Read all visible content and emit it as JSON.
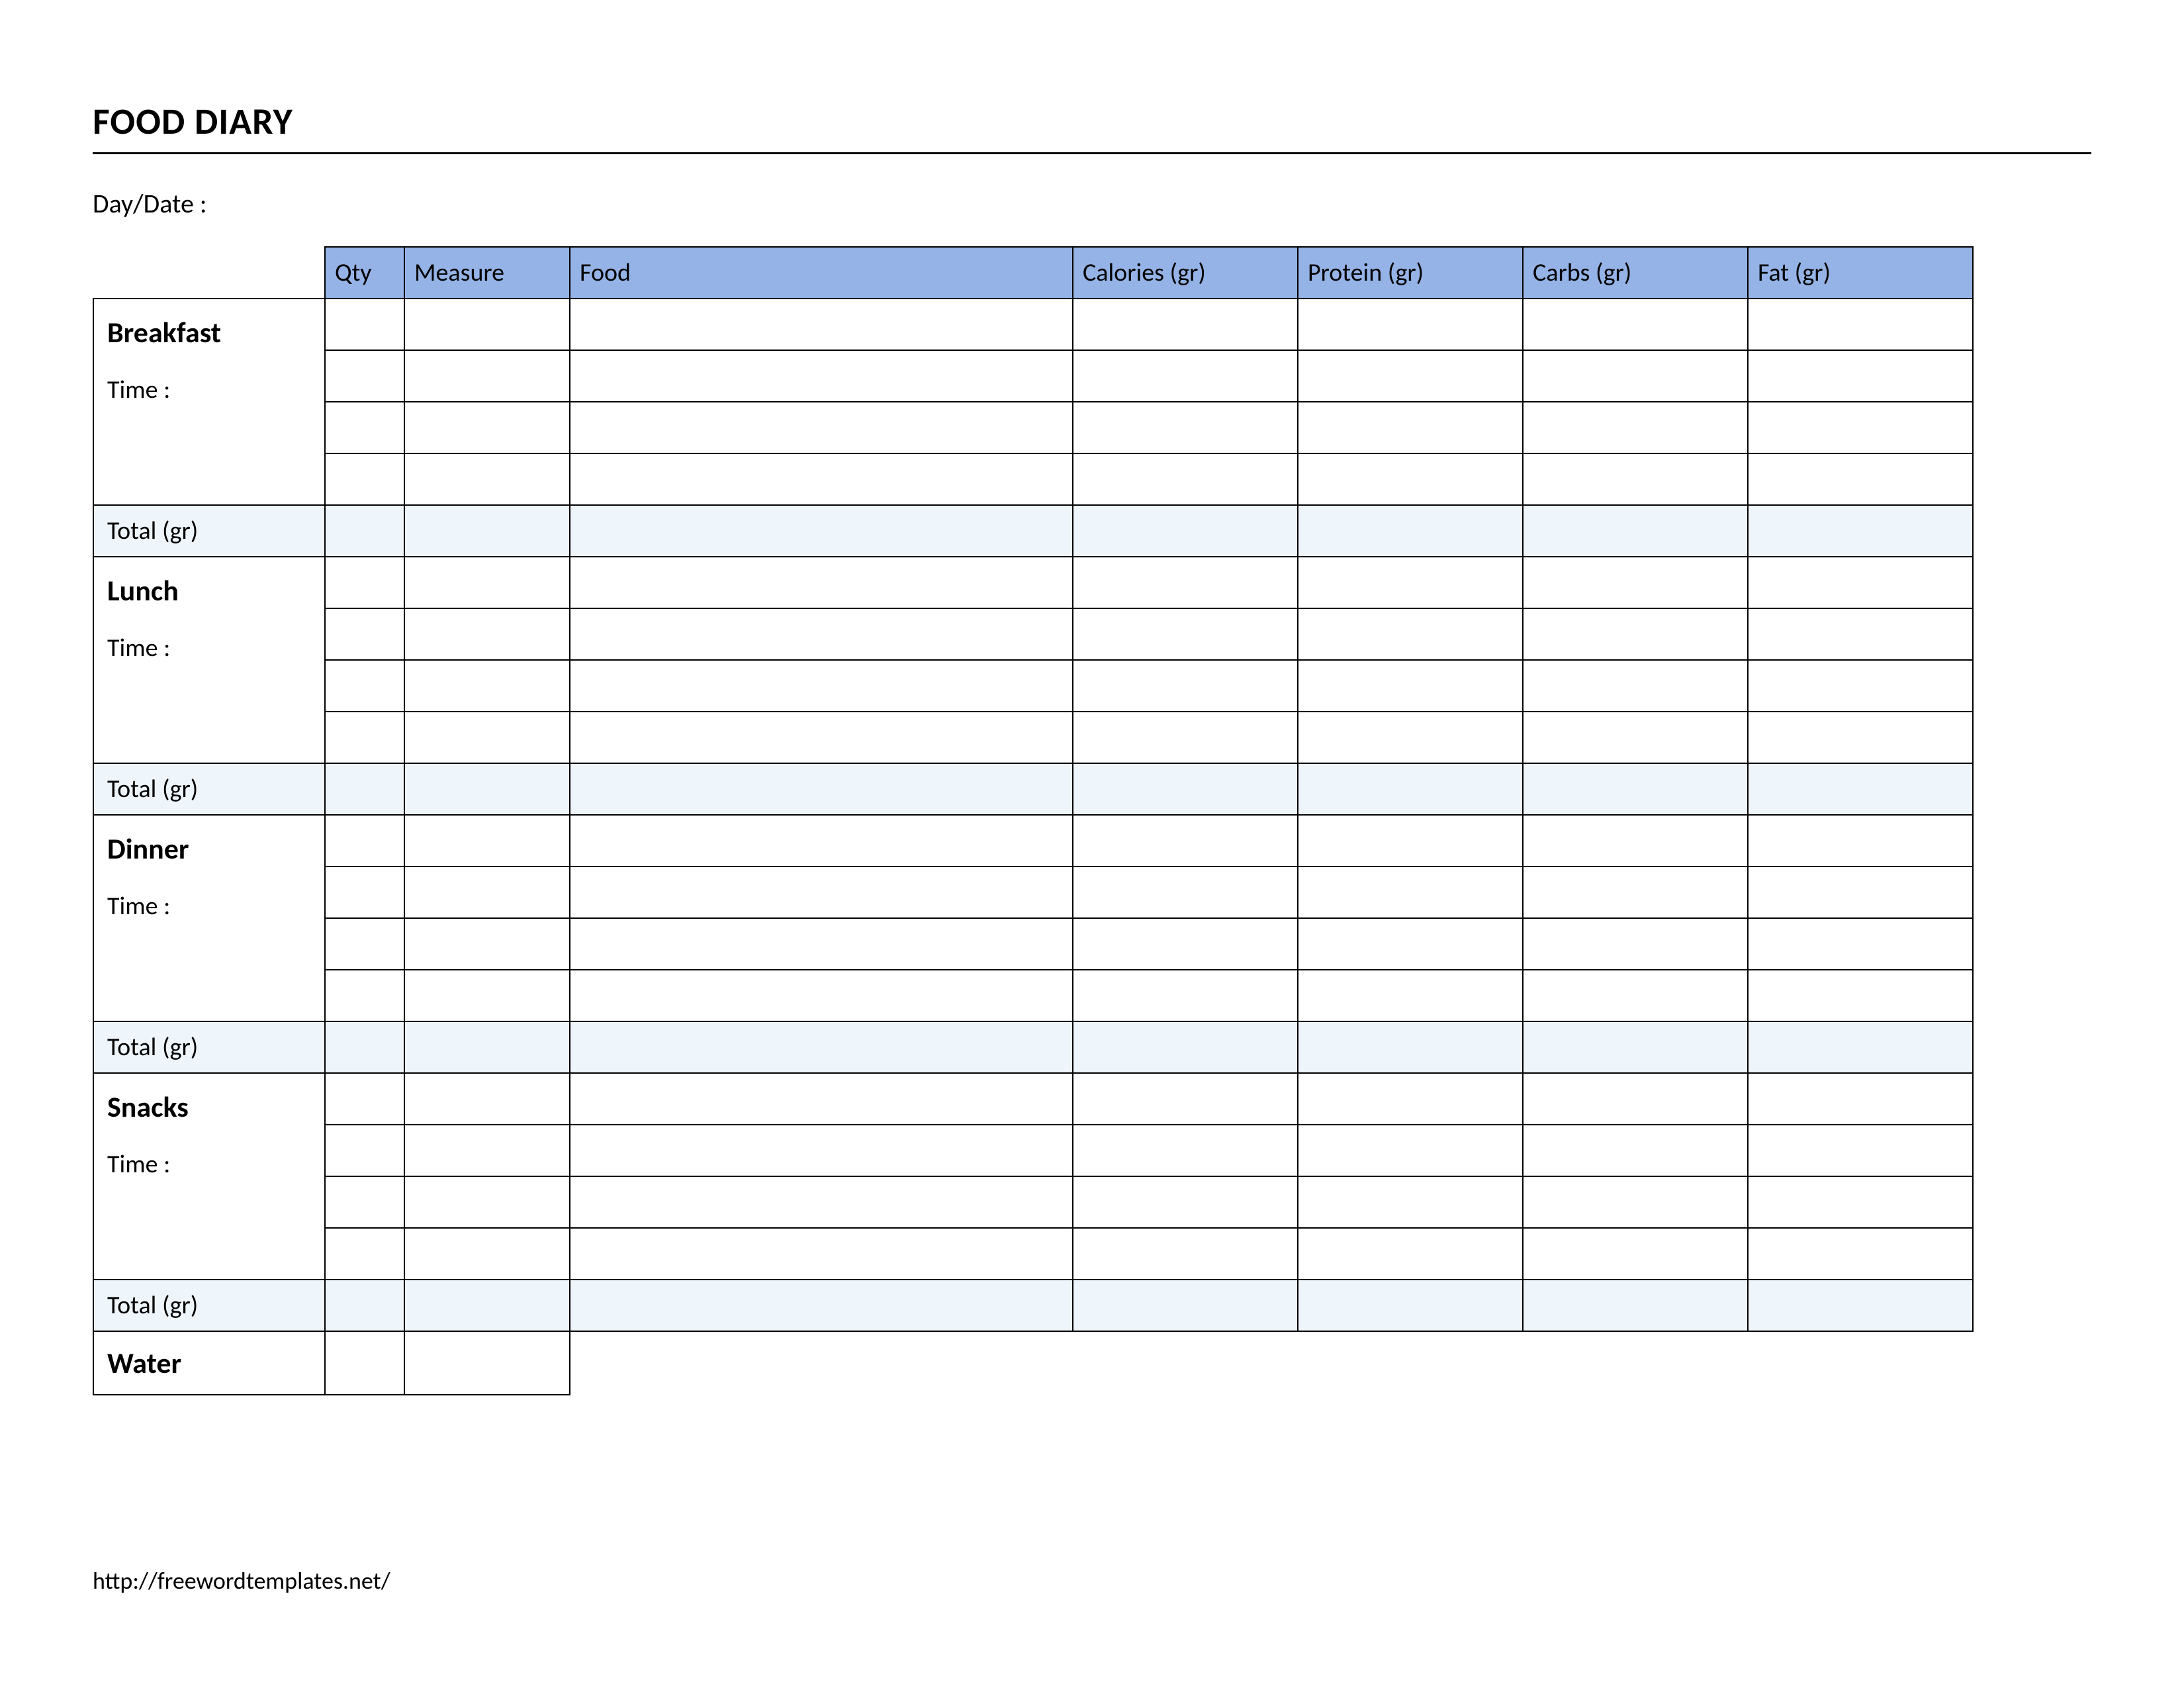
{
  "title": "FOOD DIARY",
  "day_date_label": "Day/Date :",
  "columns": {
    "qty": "Qty",
    "measure": "Measure",
    "food": "Food",
    "calories": "Calories (gr)",
    "protein": "Protein (gr)",
    "carbs": "Carbs (gr)",
    "fat": "Fat (gr)"
  },
  "meals": [
    {
      "name": "Breakfast",
      "time_label": "Time :",
      "total_label": "Total (gr)"
    },
    {
      "name": "Lunch",
      "time_label": "Time :",
      "total_label": "Total (gr)"
    },
    {
      "name": "Dinner",
      "time_label": "Time :",
      "total_label": "Total (gr)"
    },
    {
      "name": "Snacks",
      "time_label": "Time :",
      "total_label": "Total (gr)"
    }
  ],
  "water_label": "Water",
  "footer_url": "http://freewordtemplates.net/"
}
